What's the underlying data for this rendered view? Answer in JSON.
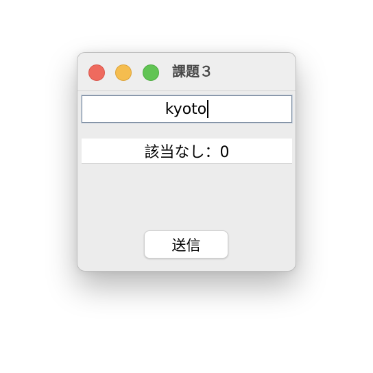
{
  "window": {
    "title": "課題３",
    "controls": {
      "close": "close-button",
      "minimize": "minimize-button",
      "zoom": "zoom-button"
    }
  },
  "form": {
    "input_value": "kyoto",
    "result_text": "該当なし：0",
    "send_label": "送信"
  },
  "colors": {
    "close": "#ee6a5e",
    "minimize": "#f5bd4f",
    "zoom": "#61c454",
    "window_bg": "#ececec"
  }
}
